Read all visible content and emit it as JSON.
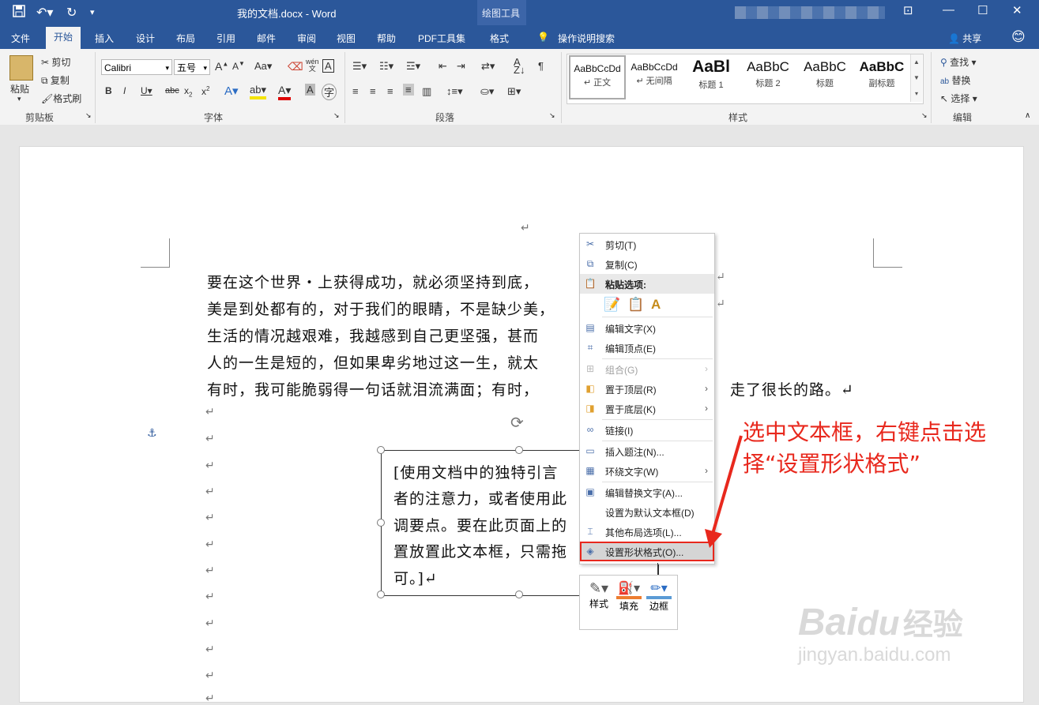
{
  "window": {
    "document_title": "我的文档.docx",
    "app_name": "Word",
    "separator": "-",
    "contextual_group": "绘图工具"
  },
  "tabs": [
    "文件",
    "开始",
    "插入",
    "设计",
    "布局",
    "引用",
    "邮件",
    "审阅",
    "视图",
    "帮助",
    "PDF工具集",
    "格式"
  ],
  "active_tab": "开始",
  "tell_me": "操作说明搜索",
  "share": "共享",
  "clipboard": {
    "paste": "粘贴",
    "cut": "剪切",
    "copy": "复制",
    "format_painter": "格式刷",
    "group_label": "剪贴板"
  },
  "font": {
    "name": "Calibri",
    "size": "五号",
    "group_label": "字体",
    "case": "Aa",
    "phonetic": "wén"
  },
  "paragraph": {
    "group_label": "段落"
  },
  "styles": {
    "group_label": "样式",
    "items": [
      {
        "preview": "AaBbCcDd",
        "name": "↵ 正文"
      },
      {
        "preview": "AaBbCcDd",
        "name": "↵ 无间隔"
      },
      {
        "preview": "AaBl",
        "name": "标题 1"
      },
      {
        "preview": "AaBbC",
        "name": "标题 2"
      },
      {
        "preview": "AaBbC",
        "name": "标题"
      },
      {
        "preview": "AaBbC",
        "name": "副标题"
      }
    ]
  },
  "editing": {
    "group_label": "编辑",
    "find": "查找",
    "replace": "替换",
    "select": "选择"
  },
  "document": {
    "top_mark": "↵",
    "lines": [
      "要在这个世界・上获得成功，就必须坚持到底，",
      "美是到处都有的，对于我们的眼睛，不是缺少美，",
      "生活的情况越艰难，我越感到自己更坚强，甚而",
      "人的一生是短的，但如果卑劣地过这一生，就太",
      "有时，我可能脆弱得一句话就泪流满面；有时，"
    ],
    "right_fragments": [
      "↵",
      "↵",
      "",
      "",
      "走了很长的路。↵"
    ],
    "empty_marks": 12,
    "textbox_lines": [
      "[使用文档中的独特引言",
      "者的注意力，或者使用此",
      "调要点。要在此页面上的",
      "置放置此文本框，只需拖",
      "可。]↵"
    ]
  },
  "context_menu": {
    "items": [
      {
        "label": "剪切(T)",
        "icon": "scissors-icon",
        "glyph": "✂",
        "disabled": false,
        "submenu": false
      },
      {
        "label": "复制(C)",
        "icon": "copy-icon",
        "glyph": "⧉",
        "disabled": false,
        "submenu": false
      },
      {
        "label": "粘贴选项:",
        "icon": "paste-icon",
        "glyph": "📋",
        "disabled": false,
        "submenu": false,
        "header": true
      },
      {
        "label": "编辑文字(X)",
        "icon": "edit-text-icon",
        "glyph": "▤",
        "disabled": false,
        "submenu": false
      },
      {
        "label": "编辑顶点(E)",
        "icon": "edit-points-icon",
        "glyph": "⌗",
        "disabled": false,
        "submenu": false
      },
      {
        "label": "组合(G)",
        "icon": "group-icon",
        "glyph": "⊞",
        "disabled": true,
        "submenu": true
      },
      {
        "label": "置于顶层(R)",
        "icon": "bring-front-icon",
        "glyph": "◧",
        "disabled": false,
        "submenu": true
      },
      {
        "label": "置于底层(K)",
        "icon": "send-back-icon",
        "glyph": "◨",
        "disabled": false,
        "submenu": true
      },
      {
        "label": "链接(I)",
        "icon": "link-icon",
        "glyph": "∞",
        "disabled": false,
        "submenu": false
      },
      {
        "label": "插入题注(N)...",
        "icon": "caption-icon",
        "glyph": "▭",
        "disabled": false,
        "submenu": false
      },
      {
        "label": "环绕文字(W)",
        "icon": "wrap-text-icon",
        "glyph": "▦",
        "disabled": false,
        "submenu": true
      },
      {
        "label": "编辑替换文字(A)...",
        "icon": "alt-text-icon",
        "glyph": "▣",
        "disabled": false,
        "submenu": false
      },
      {
        "label": "设置为默认文本框(D)",
        "icon": "",
        "glyph": "",
        "disabled": false,
        "submenu": false
      },
      {
        "label": "其他布局选项(L)...",
        "icon": "layout-icon",
        "glyph": "⌶",
        "disabled": false,
        "submenu": false
      },
      {
        "label": "设置形状格式(O)...",
        "icon": "format-shape-icon",
        "glyph": "◈",
        "disabled": false,
        "submenu": false,
        "highlighted": true
      }
    ]
  },
  "mini_toolbar": {
    "style": "样式",
    "fill": "填充",
    "outline": "边框"
  },
  "annotation": {
    "line1": "选中文本框，右键点击选",
    "line2": "择“设置形状格式”",
    "color": "#e8281d"
  },
  "watermark": {
    "brand": "Bai",
    "brand2": "du",
    "site_cn": "经验",
    "url": "jingyan.baidu.com"
  },
  "colors": {
    "word_blue": "#2b579a",
    "highlight_red": "#e8281d"
  }
}
